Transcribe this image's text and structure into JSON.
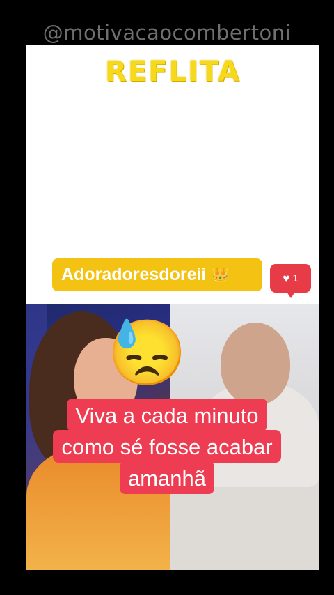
{
  "watermark": "@motivacaocombertoni",
  "headline": "REFLITA",
  "post": {
    "username": "Adoradoresdoreii",
    "username_emoji": "👑",
    "likes": "1",
    "reaction_emoji": "😓"
  },
  "caption": {
    "line1": "Viva  a cada minuto",
    "line2": "como sé fosse acabar",
    "line3": "amanhã"
  },
  "colors": {
    "headline": "#f7d91b",
    "tag": "#f4c213",
    "like": "#e83b48",
    "caption_bg": "#ee3d53"
  },
  "icons": {
    "like": "heart-icon",
    "crown": "crown-emoji"
  }
}
